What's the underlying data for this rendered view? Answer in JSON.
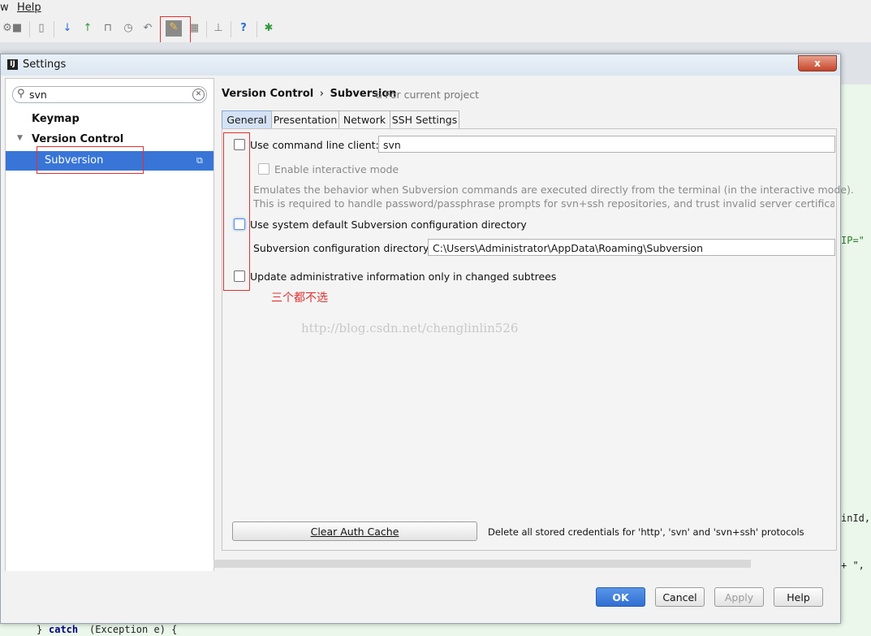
{
  "menu": {
    "items": [
      "w",
      "Help"
    ]
  },
  "dialog": {
    "title": "Settings",
    "icon_text": "IJ",
    "close_glyph": "x"
  },
  "search": {
    "value": "svn"
  },
  "tree": {
    "items": [
      {
        "label": "Keymap"
      },
      {
        "label": "Version Control",
        "expanded": true
      },
      {
        "label": "Subversion",
        "selected": true
      }
    ]
  },
  "breadcrumb": {
    "parent": "Version Control",
    "separator": "›",
    "current": "Subversion",
    "scope": "For current project"
  },
  "tabs": [
    "General",
    "Presentation",
    "Network",
    "SSH Settings"
  ],
  "general": {
    "use_cmd_client": {
      "label": "Use command line client:",
      "value": "svn",
      "checked": false
    },
    "interactive": {
      "label": "Enable interactive mode",
      "checked": false,
      "disabled": true
    },
    "desc_line1": "Emulates the behavior when Subversion commands are executed directly from the terminal (in the interactive mode).",
    "desc_line2": "This is required to handle password/passphrase prompts for svn+ssh repositories, and trust invalid server certificates for h",
    "use_sys_default": {
      "label": "Use system default Subversion configuration directory",
      "checked": false
    },
    "config_dir": {
      "label": "Subversion configuration directory:",
      "value": "C:\\Users\\Administrator\\AppData\\Roaming\\Subversion"
    },
    "update_admin": {
      "label": "Update administrative information only in changed subtrees",
      "checked": false
    },
    "annotation": "三个都不选",
    "watermark": "http://blog.csdn.net/chenglinlin526",
    "clear_cache_label": "Clear Auth Cache",
    "clear_cache_desc": "Delete all stored credentials for 'http', 'svn' and 'svn+ssh' protocols"
  },
  "buttons": {
    "ok": "OK",
    "cancel": "Cancel",
    "apply": "Apply",
    "help": "Help"
  },
  "background_code": {
    "line_right1": "IP=\"",
    "line_right2": "inId,",
    "line_right3": "+ \",",
    "bottom_close": "}",
    "bottom_catch": "catch",
    "bottom_rest": "(Exception e) {"
  },
  "colors": {
    "accent": "#3875d7",
    "ok_button": "#2f6fd3",
    "annotation": "#e03030"
  }
}
